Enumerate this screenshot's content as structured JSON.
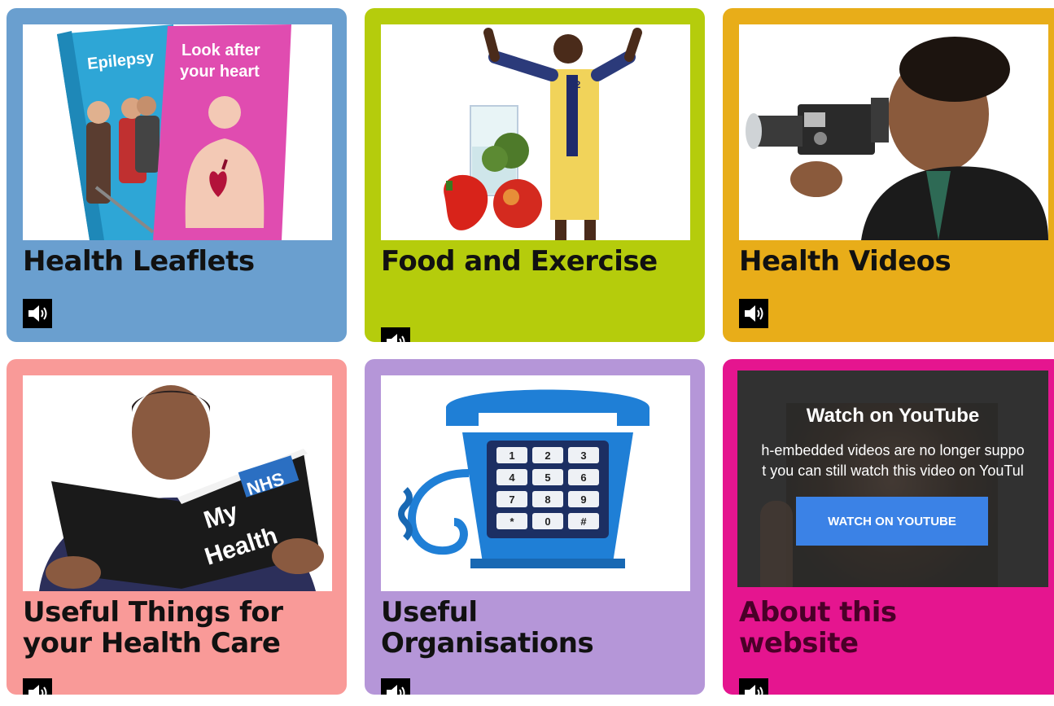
{
  "cards": [
    {
      "title": "Health Leaflets",
      "color": "#6a9fcf",
      "image": "health-leaflets-image",
      "leaflet_left_text": "Epilepsy",
      "leaflet_right_text": "Look after your heart"
    },
    {
      "title": "Food and Exercise",
      "color": "#b5cc0c",
      "image": "food-and-exercise-image",
      "shirt_number": "12"
    },
    {
      "title": "Health Videos",
      "color": "#e8ad19",
      "image": "video-camera-man-image"
    },
    {
      "title": "Useful Things for your Health Care",
      "color": "#f99a98",
      "image": "my-nhs-health-book-image",
      "book_badge": "NHS",
      "book_line1": "My",
      "book_line2": "Health"
    },
    {
      "title": "Useful Organisations",
      "color": "#b596d8",
      "image": "telephone-image",
      "phone_keys": [
        "1",
        "2",
        "3",
        "4",
        "5",
        "6",
        "7",
        "8",
        "9",
        "*",
        "0",
        "#"
      ]
    },
    {
      "title": "About this website",
      "color": "#e5158f",
      "image": "youtube-embed",
      "title_color": "#4a0028"
    }
  ],
  "youtube": {
    "title": "Watch on YouTube",
    "line1": "h-embedded videos are no longer suppo",
    "line2": "t you can still watch this video on YouTul",
    "button_label": "WATCH ON YOUTUBE",
    "button_color": "#3b82e6"
  },
  "speaker_icon": "speaker-audio-icon"
}
